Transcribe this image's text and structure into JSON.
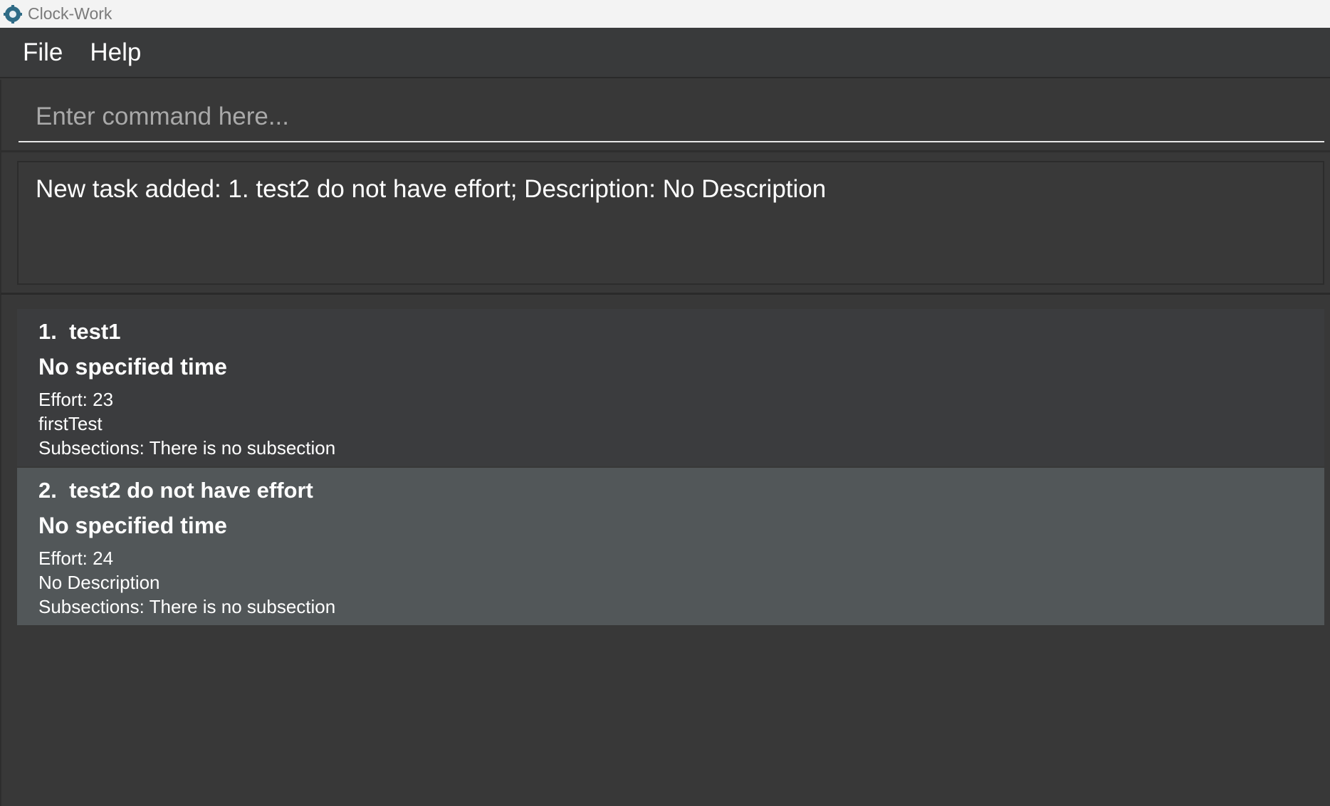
{
  "window": {
    "title": "Clock-Work",
    "icon": "gear-app-icon"
  },
  "menu": {
    "items": [
      "File",
      "Help"
    ]
  },
  "command": {
    "placeholder": "Enter command here...",
    "value": ""
  },
  "result": {
    "message": "New task added: 1. test2 do not have effort; Description: No Description"
  },
  "tasks": [
    {
      "index": "1.",
      "name": "test1",
      "time": "No specified time",
      "effort": "Effort: 23",
      "description": "firstTest",
      "subsections": "Subsections: There is no subsection"
    },
    {
      "index": "2.",
      "name": "test2 do not have effort",
      "time": "No specified time",
      "effort": "Effort: 24",
      "description": "No Description",
      "subsections": "Subsections: There is no subsection"
    }
  ],
  "colors": {
    "background": "#383838",
    "card_default": "#3b3c3e",
    "card_selected": "#525759",
    "text": "#ffffff"
  }
}
